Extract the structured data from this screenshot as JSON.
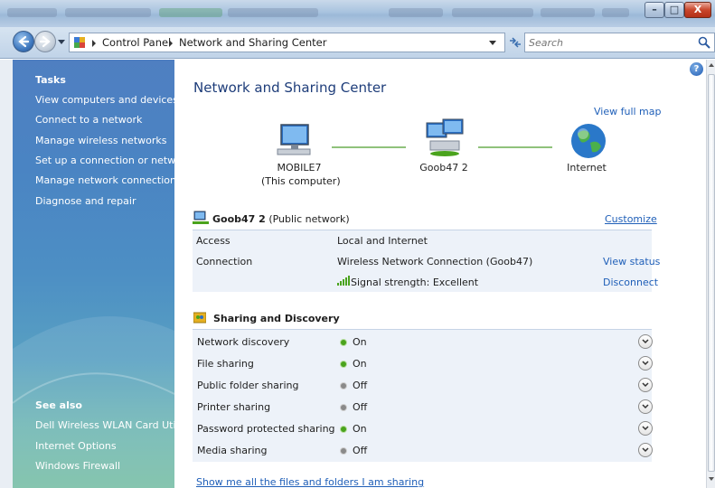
{
  "window": {
    "minimize_label": "–",
    "maximize_label": "□",
    "close_label": "X"
  },
  "address_bar": {
    "breadcrumbs": [
      "Control Panel",
      "Network and Sharing Center"
    ],
    "search_placeholder": "Search"
  },
  "sidebar": {
    "tasks_heading": "Tasks",
    "tasks": [
      "View computers and devices",
      "Connect to a network",
      "Manage wireless networks",
      "Set up a connection or network",
      "Manage network connections",
      "Diagnose and repair"
    ],
    "see_also_heading": "See also",
    "see_also": [
      "Dell Wireless WLAN Card Utility",
      "Internet Options",
      "Windows Firewall"
    ]
  },
  "main": {
    "title": "Network and Sharing Center",
    "view_full_map": "View full map",
    "map": {
      "computer_name": "MOBILE7",
      "computer_sub": "(This computer)",
      "network_name": "Goob47  2",
      "internet": "Internet"
    },
    "network": {
      "name": "Goob47  2",
      "type": "(Public network)",
      "customize": "Customize",
      "rows": {
        "access_label": "Access",
        "access_value": "Local and Internet",
        "connection_label": "Connection",
        "connection_value": "Wireless Network Connection (Goob47)",
        "view_status": "View status",
        "signal_text": "Signal strength:  Excellent",
        "disconnect": "Disconnect"
      }
    },
    "sharing": {
      "heading": "Sharing and Discovery",
      "items": [
        {
          "label": "Network discovery",
          "value": "On",
          "state": "on"
        },
        {
          "label": "File sharing",
          "value": "On",
          "state": "on"
        },
        {
          "label": "Public folder sharing",
          "value": "Off",
          "state": "off"
        },
        {
          "label": "Printer sharing",
          "value": "Off",
          "state": "off"
        },
        {
          "label": "Password protected sharing",
          "value": "On",
          "state": "on"
        },
        {
          "label": "Media sharing",
          "value": "Off",
          "state": "off"
        }
      ]
    },
    "show_files_link": "Show me all the files and folders I am sharing",
    "help_label": "?"
  },
  "colors": {
    "link": "#1f5fb8",
    "status_on": "#4aa31d",
    "status_off": "#8a8a8a",
    "sidebar_top": "#4f7fc1",
    "sidebar_bottom": "#79bfa6"
  }
}
